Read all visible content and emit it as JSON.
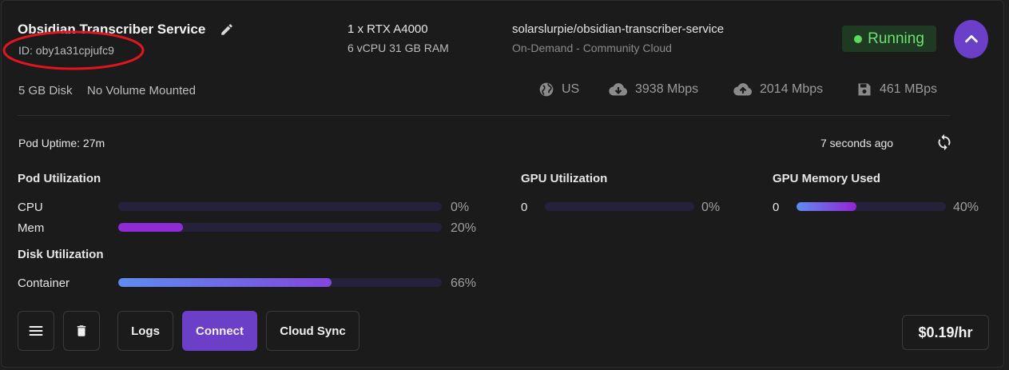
{
  "pod": {
    "title": "Obsidian Transcriber Service",
    "id_text": "ID: oby1a31cpjufc9",
    "gpu": "1 x RTX A4000",
    "cpu_ram": "6 vCPU 31 GB RAM",
    "image": "solarslurpie/obsidian-transcriber-service",
    "cloud": "On-Demand - Community Cloud",
    "status": "Running",
    "disk": "5 GB Disk",
    "volume": "No Volume Mounted"
  },
  "stats": {
    "region": "US",
    "download": "3938 Mbps",
    "upload": "2014 Mbps",
    "disk_speed": "461 MBps"
  },
  "uptime": {
    "text": "Pod Uptime: 27m",
    "last_update": "7 seconds ago"
  },
  "pod_utilization": {
    "heading": "Pod Utilization",
    "cpu_label": "CPU",
    "cpu_pct": "0%",
    "cpu_value": 0,
    "mem_label": "Mem",
    "mem_pct": "20%",
    "mem_value": 20
  },
  "disk_utilization": {
    "heading": "Disk Utilization",
    "container_label": "Container",
    "container_pct": "66%",
    "container_value": 66
  },
  "gpu_utilization": {
    "heading": "GPU Utilization",
    "index": "0",
    "pct": "0%",
    "value": 0
  },
  "gpu_memory": {
    "heading": "GPU Memory Used",
    "index": "0",
    "pct": "40%",
    "value": 40
  },
  "buttons": {
    "logs": "Logs",
    "connect": "Connect",
    "cloud_sync": "Cloud Sync"
  },
  "price": "$0.19/hr",
  "colors": {
    "accent": "#6c3fc9",
    "running_bg": "#1f3a23",
    "running_text": "#6fe06f",
    "annotation": "#e0161e"
  },
  "icons": [
    "pencil-icon",
    "globe-icon",
    "cloud-download-icon",
    "cloud-upload-icon",
    "save-disk-icon",
    "refresh-icon",
    "menu-icon",
    "trash-icon",
    "chevron-up-icon"
  ]
}
